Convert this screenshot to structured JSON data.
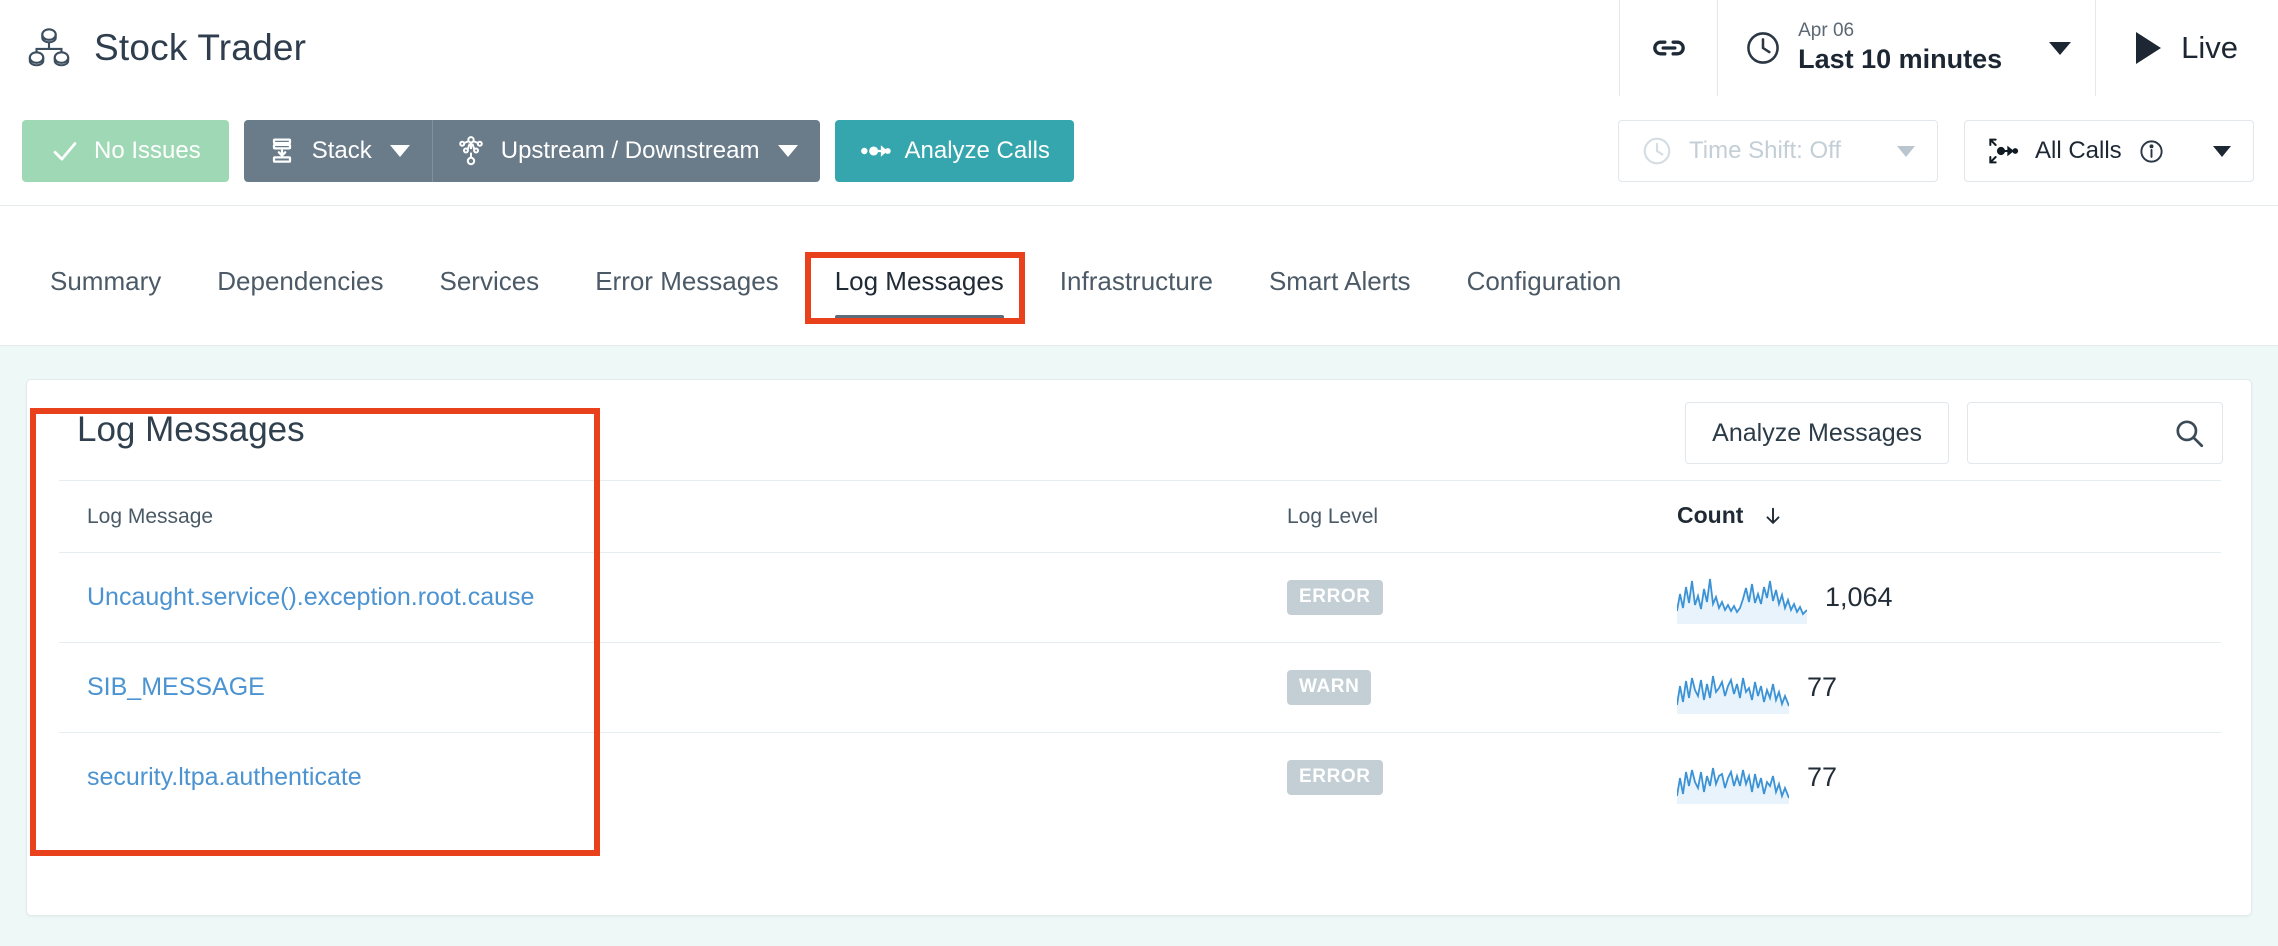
{
  "header": {
    "app_icon": "service-topology-icon",
    "title": "Stock Trader",
    "link_icon": "link-icon",
    "time_picker": {
      "clock_icon": "clock-icon",
      "date": "Apr 06",
      "range": "Last 10 minutes",
      "caret_icon": "chevron-down-icon"
    },
    "live": {
      "play_icon": "play-icon",
      "label": "Live"
    }
  },
  "toolbar": {
    "no_issues": {
      "icon": "check-icon",
      "label": "No Issues"
    },
    "stack": {
      "icon": "stack-icon",
      "label": "Stack",
      "caret_icon": "chevron-down-icon"
    },
    "upstream_downstream": {
      "icon": "topology-icon",
      "label": "Upstream / Downstream",
      "caret_icon": "chevron-down-icon"
    },
    "analyze_calls": {
      "icon": "calls-icon",
      "label": "Analyze Calls"
    },
    "time_shift": {
      "icon": "clock-icon",
      "label": "Time Shift: Off",
      "caret_icon": "chevron-down-icon"
    },
    "all_calls": {
      "icon": "call-direction-icon",
      "label": "All Calls",
      "info_icon": "info-icon",
      "caret_icon": "chevron-down-icon"
    }
  },
  "tabs": [
    {
      "label": "Summary",
      "active": false
    },
    {
      "label": "Dependencies",
      "active": false
    },
    {
      "label": "Services",
      "active": false
    },
    {
      "label": "Error Messages",
      "active": false
    },
    {
      "label": "Log Messages",
      "active": true
    },
    {
      "label": "Infrastructure",
      "active": false
    },
    {
      "label": "Smart Alerts",
      "active": false
    },
    {
      "label": "Configuration",
      "active": false
    }
  ],
  "panel": {
    "title": "Log Messages",
    "analyze_messages_label": "Analyze Messages",
    "search": {
      "value": "",
      "placeholder": "",
      "icon": "search-icon"
    },
    "table": {
      "columns": [
        "Log Message",
        "Log Level",
        "Count"
      ],
      "sort_column": "Count",
      "sort_direction": "desc",
      "sort_icon": "arrow-down-icon",
      "rows": [
        {
          "message": "Uncaught.service().exception.root.cause",
          "level": "ERROR",
          "count": "1,064"
        },
        {
          "message": "SIB_MESSAGE",
          "level": "WARN",
          "count": "77"
        },
        {
          "message": "security.ltpa.authenticate",
          "level": "ERROR",
          "count": "77"
        }
      ]
    }
  },
  "colors": {
    "accent_teal": "#35a6ae",
    "grey_button": "#6a7c89",
    "green_ok": "#9ed8b4",
    "link_blue": "#4b93d1",
    "badge_grey": "#c3cfd4",
    "annotation_red": "#e8411c",
    "page_background": "#eef8f6",
    "sparkline_blue": "#3b93d6"
  },
  "annotations": [
    {
      "name": "log-messages-tab-highlight"
    },
    {
      "name": "log-messages-column-highlight"
    }
  ],
  "chart_data": [
    {
      "type": "line",
      "title": "Uncaught.service().exception.root.cause count sparkline",
      "series": [
        {
          "name": "count",
          "values": [
            22,
            55,
            28,
            64,
            34,
            70,
            30,
            48,
            26,
            40,
            58,
            33,
            72,
            30,
            44,
            26,
            38,
            22,
            30,
            25,
            34,
            22,
            29,
            48,
            60,
            38,
            66,
            32,
            50,
            30,
            62,
            42,
            70,
            36,
            58,
            30,
            44,
            26,
            40,
            24,
            32,
            20,
            28,
            18,
            24,
            16
          ]
        }
      ],
      "ylim": [
        0,
        80
      ],
      "grid": false,
      "legend": "none"
    },
    {
      "type": "line",
      "title": "SIB_MESSAGE count sparkline",
      "series": [
        {
          "name": "count",
          "values": [
            18,
            50,
            24,
            58,
            30,
            62,
            26,
            54,
            32,
            60,
            28,
            56,
            34,
            64,
            30,
            52,
            26,
            58,
            32,
            60,
            28,
            54,
            30,
            62,
            26,
            50,
            34,
            58,
            30,
            56,
            24,
            48,
            28,
            52,
            30,
            46,
            26,
            42,
            22,
            38
          ]
        }
      ],
      "ylim": [
        0,
        70
      ],
      "grid": false,
      "legend": "none"
    },
    {
      "type": "line",
      "title": "security.ltpa.authenticate count sparkline",
      "series": [
        {
          "name": "count",
          "values": [
            16,
            46,
            22,
            56,
            28,
            60,
            24,
            52,
            30,
            58,
            26,
            54,
            32,
            62,
            28,
            50,
            24,
            56,
            30,
            58,
            26,
            52,
            28,
            60,
            24,
            48,
            32,
            56,
            28,
            54,
            22,
            46,
            26,
            50,
            28,
            44,
            24,
            40,
            20,
            36
          ]
        }
      ],
      "ylim": [
        0,
        70
      ],
      "grid": false,
      "legend": "none"
    }
  ]
}
